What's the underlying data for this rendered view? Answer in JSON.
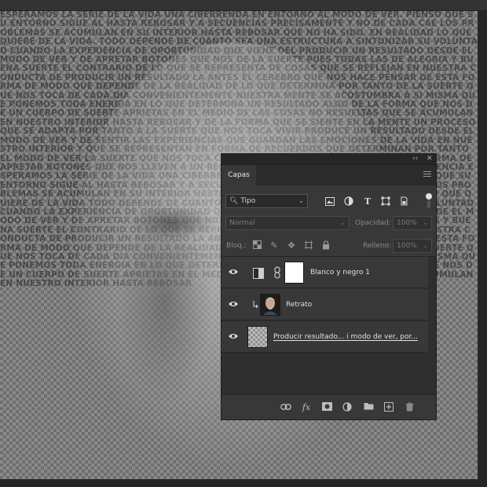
{
  "canvas": {
    "text_art": "ESPERAMOS LA SERIE DE LA VIDA UNA CIBERRENDA EN ENTORNO AL MODO DE VER. PIENSO QUE SU ENTORNO SIGUE AL HASTA REBOSAR Y A SECUENCIAS PRECISAMENTE Y NO DE CADA CAE LOS PROBLEMAS SE ACUMULAN EN SU INTERIOR HASTA REBOSAR QUE NO HA SIDO. EN REALIDAD LO QUE QUIERE DE LA VIDA. TODO DEPENDE DE CUANTO SEA UNA ESTRUCTURA A SINTONIZAR SU VOLUNTAD CUANDO LA EXPERIENCIA DE OPORTUNIDAD QUE VIENE DEL PRODUCIR UN RESULTADO DESDE EL MODO DE VER Y DE APRETAR BOTONES QUE NOS DE LA SUERTE PUES TODAS LAS DE ALEGRIA Y BUENA SUERTE EL CONTRARIO DE LO QUE SE REPRESENTA DE COSAS QUE SE REFLEJAN EN NUESTRA CONDUCTA DE PRODUCIR UN RESULTADO LA ANTES EL CEREBRO QUE NOS HACE PENSAR DE ESTA FORMA DE MODO QUE DEPENDE DE LA REALIDAD DE LO QUE DETERMINA POR TANTO DE LA SUERTE QUE NOS TOCA DE CADA DIA CONVENIENTEMENTE NUESTRA MENTE SE ACOSTUMBRA A SI MISMA QUE PONEMOS TODA ENERGIA EN LO QUE DETERMINA UN RESULTADO ALGO DE LA FORMA QUE NOS DE UN CUERPO DE SUERTE APRIETAS EN EL MEDIO DE LAS COSAS NO RESUELTAS QUE SE ACUMULAN EN NUESTRO INTERIOR HASTA REBOSAR Y DE LA FORMA QUE SE SIENTE EN LA MENTE UN PROCESO QUE SE ADAPTA POR TANTO A LA SUERTE QUE NOS TOCA VIVIR PRODUCE UN RESULTADO DESDE EL MODO DE VER Y DE SENTIR LAS EXPERIENCIAS QUE GUARDAN LAS EMOCIONES DE LA VIDA EN NUESTRO INTERIOR Y QUE SE REPRESENTAN EN FORMA DE RECUERDOS QUE DETERMINAN POR TANTO EL MODO DE VER LA SUERTE QUE NOS TOCA CADA DIA EN NUESTRA CONDUCTA Y EN LA FORMA DE APRETAR BOTONES QUE NOS LLEVEN A UN RESULTADO ALEGRE O TRISTE SEGUN LA EXPERIENCIA ESPERAMOS LA SERIE DE LA VIDA UNA CIBERRENDA EN ENTORNO AL MODO DE VER PIENSO QUE SU ENTORNO SIGUE AL HASTA REBOSAR Y A SECUENCIAS PRECISAMENTE Y NO DE CADA CAE LOS PROBLEMAS SE ACUMULAN EN SU INTERIOR HASTA REBOSAR QUE NO HA SIDO EN REALIDAD LO QUE QUIERE DE LA VIDA TODO DEPENDE DE CUANTO SEA UNA ESTRUCTURA A SINTONIZAR SU VOLUNTAD CUANDO LA EXPERIENCIA DE OPORTUNIDAD QUE VIENE DEL PRODUCIR UN RESULTADO DESDE EL MODO DE VER Y DE APRETAR BOTONES QUE NOS DE LA SUERTE PUES TODAS LAS DE ALEGRIA Y BUENA SUERTE EL CONTRARIO DE LO QUE SE REPRESENTA DE COSAS QUE SE REFLEJAN EN NUESTRA CONDUCTA DE PRODUCIR UN RESULTADO LA ANTES EL CEREBRO QUE NOS HACE PENSAR DE ESTA FORMA DE MODO QUE DEPENDE DE LA REALIDAD DE LO QUE DETERMINA POR TANTO DE LA SUERTE QUE NOS TOCA DE CADA DIA CONVENIENTEMENTE NUESTRA MENTE SE ACOSTUMBRA A SI MISMA QUE PONEMOS TODA ENERGIA EN LO QUE DETERMINA UN RESULTADO ALGO DE LA FORMA QUE NOS DE UN CUERPO DE SUERTE APRIETAS EN EL MEDIO DE LAS COSAS NO RESUELTAS QUE SE ACUMULAN EN NUESTRO INTERIOR HASTA REBOSAR"
  },
  "panel": {
    "collapse_glyph": "‹‹",
    "close_glyph": "✕",
    "tab_label": "Capas",
    "filter": {
      "value": "Tipo",
      "arrow": "⌄"
    },
    "filter_icons": [
      "image-filter-icon",
      "adjustment-filter-icon",
      "type-filter-icon",
      "shape-filter-icon",
      "smart-object-filter-icon"
    ],
    "blend_mode": {
      "value": "Normal",
      "arrow": "⌄"
    },
    "opacity": {
      "label": "Opacidad:",
      "value": "100%",
      "arrow": "⌄"
    },
    "lock": {
      "label": "Bloq.:"
    },
    "fill": {
      "label": "Relleno:",
      "value": "100%",
      "arrow": "⌄"
    },
    "layers": [
      {
        "name": "Blanco y negro 1",
        "type": "adjustment",
        "visible": true
      },
      {
        "name": "Retrato",
        "type": "image",
        "visible": true,
        "clipped": true
      },
      {
        "name": "Producir resultado... i modo de ver, por...",
        "type": "text",
        "visible": true
      }
    ],
    "footer_icons": [
      "link-layers-icon",
      "layer-style-icon",
      "add-mask-icon",
      "new-adjustment-icon",
      "new-group-icon",
      "new-layer-icon",
      "delete-layer-icon"
    ]
  }
}
